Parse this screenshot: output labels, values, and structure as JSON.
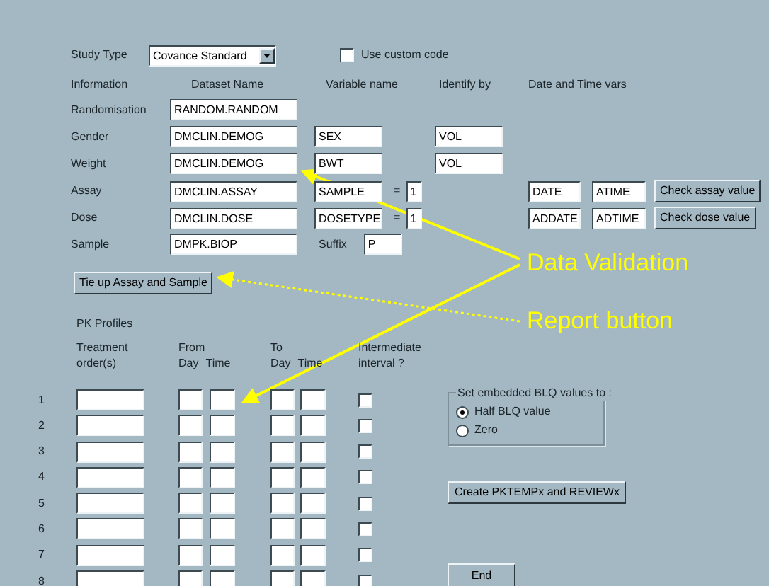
{
  "study_type": {
    "label": "Study Type",
    "value": "Covance Standard"
  },
  "custom_code": {
    "label": "Use custom code",
    "checked": false
  },
  "columns": [
    "Information",
    "Dataset Name",
    "Variable name",
    "Identify by",
    "Date and Time vars"
  ],
  "rows": [
    {
      "label": "Randomisation",
      "dataset": "RANDOM.RANDOM"
    },
    {
      "label": "Gender",
      "dataset": "DMCLIN.DEMOG",
      "variable": "SEX",
      "identify": "VOL"
    },
    {
      "label": "Weight",
      "dataset": "DMCLIN.DEMOG",
      "variable": "BWT",
      "identify": "VOL"
    },
    {
      "label": "Assay",
      "dataset": "DMCLIN.ASSAY",
      "variable": "SAMPLE",
      "equals": "=",
      "value": "1",
      "date": "DATE",
      "time": "ATIME",
      "button": "Check assay value"
    },
    {
      "label": "Dose",
      "dataset": "DMCLIN.DOSE",
      "variable": "DOSETYPE",
      "equals": "=",
      "value": "1",
      "date": "ADDATE",
      "time": "ADTIME",
      "button": "Check dose value"
    },
    {
      "label": "Sample",
      "dataset": "DMPK.BIOP",
      "suffix_label": "Suffix",
      "suffix": "P"
    }
  ],
  "tie_button": "Tie up Assay and Sample",
  "pk": {
    "title": "PK Profiles",
    "treatment": "Treatment order(s)",
    "from": "From",
    "to": "To",
    "day_from": "Day",
    "time_from": "Time",
    "day_to": "Day",
    "time_to": "Time",
    "interval": "Intermediate interval ?",
    "rows": [
      {
        "number": "1",
        "interval_checked": false
      },
      {
        "number": "2",
        "interval_checked": false
      },
      {
        "number": "3",
        "interval_checked": false
      },
      {
        "number": "4",
        "interval_checked": false
      },
      {
        "number": "5",
        "interval_checked": false
      },
      {
        "number": "6",
        "interval_checked": false
      },
      {
        "number": "7",
        "interval_checked": false
      },
      {
        "number": "8",
        "interval_checked": false
      }
    ]
  },
  "blq": {
    "legend": "Set embedded BLQ values to :",
    "options": [
      {
        "label": "Half BLQ value",
        "selected": true
      },
      {
        "label": "Zero",
        "selected": false
      }
    ]
  },
  "create_button": "Create PKTEMPx and REVIEWx",
  "end_button": "End",
  "annotations": [
    {
      "kind": "solid",
      "text": "Data Validation"
    },
    {
      "kind": "dotted",
      "text": "Report button"
    }
  ]
}
